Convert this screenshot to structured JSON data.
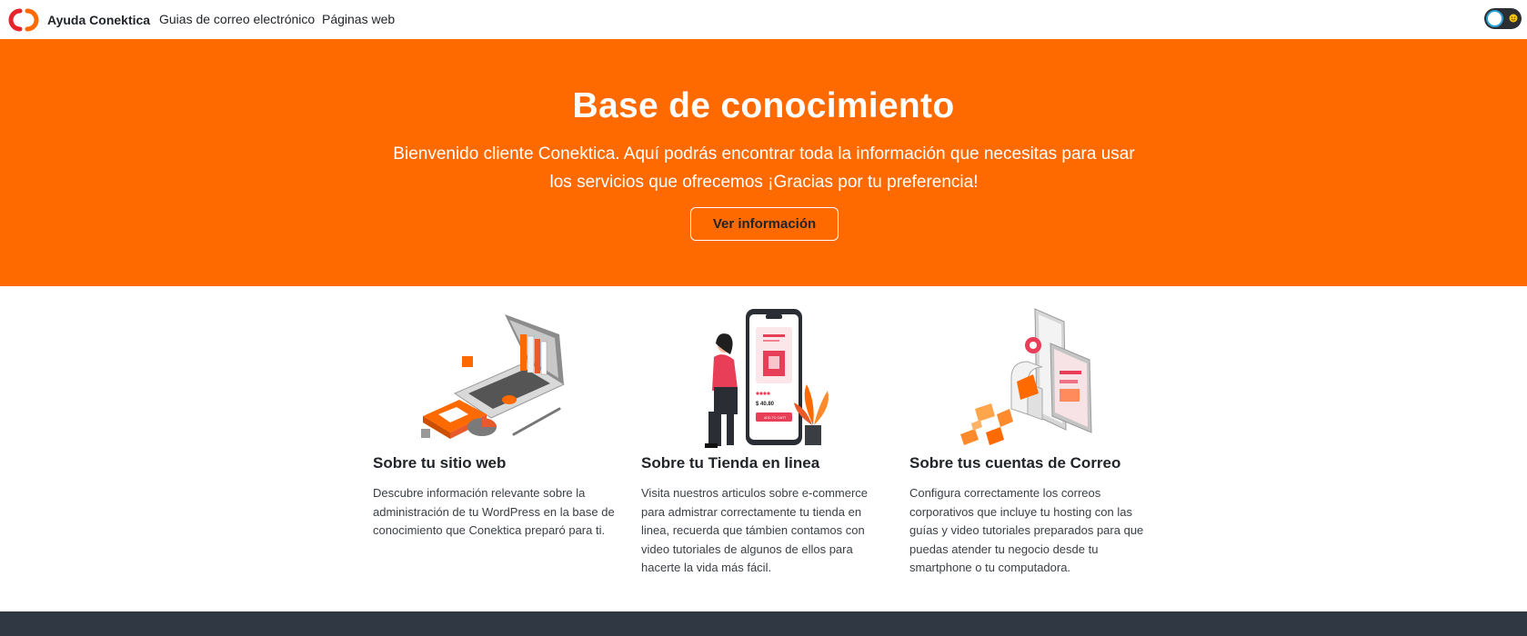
{
  "navbar": {
    "brand": "Ayuda Conektica",
    "links": [
      "Guias de correo electrónico",
      "Páginas web"
    ],
    "theme_toggle_icon": "sun-icon"
  },
  "hero": {
    "title": "Base de conocimiento",
    "subtitle": "Bienvenido cliente Conektica. Aquí podrás encontrar toda la información que necesitas para usar los servicios que ofrecemos ¡Gracias por tu preferencia!",
    "button_label": "Ver información"
  },
  "features": [
    {
      "title": "Sobre tu sitio web",
      "text": "Descubre información relevante sobre la administración de tu WordPress en la base de conocimiento que Conektica preparó para ti.",
      "illustration": "laptop-books-illustration"
    },
    {
      "title": "Sobre tu Tienda en linea",
      "text": "Visita nuestros articulos sobre e-commerce para admistrar correctamente tu tienda en linea, recuerda que támbien contamos con video tutoriales de algunos de ellos para hacerte la vida más fácil.",
      "illustration": "phone-shop-illustration",
      "price": "$ 40.80",
      "cart_label": "ADD TO CART"
    },
    {
      "title": "Sobre tus cuentas de Correo",
      "text": "Configura correctamente los correos corporativos que incluye tu hosting con las guías y video tutoriales preparados para que puedas atender tu negocio desde tu smartphone o tu computadora.",
      "illustration": "mailbox-envelopes-illustration"
    }
  ],
  "colors": {
    "brand_orange": "#ff6a00",
    "logo_red": "#e8242b",
    "footer": "#2f3843"
  }
}
